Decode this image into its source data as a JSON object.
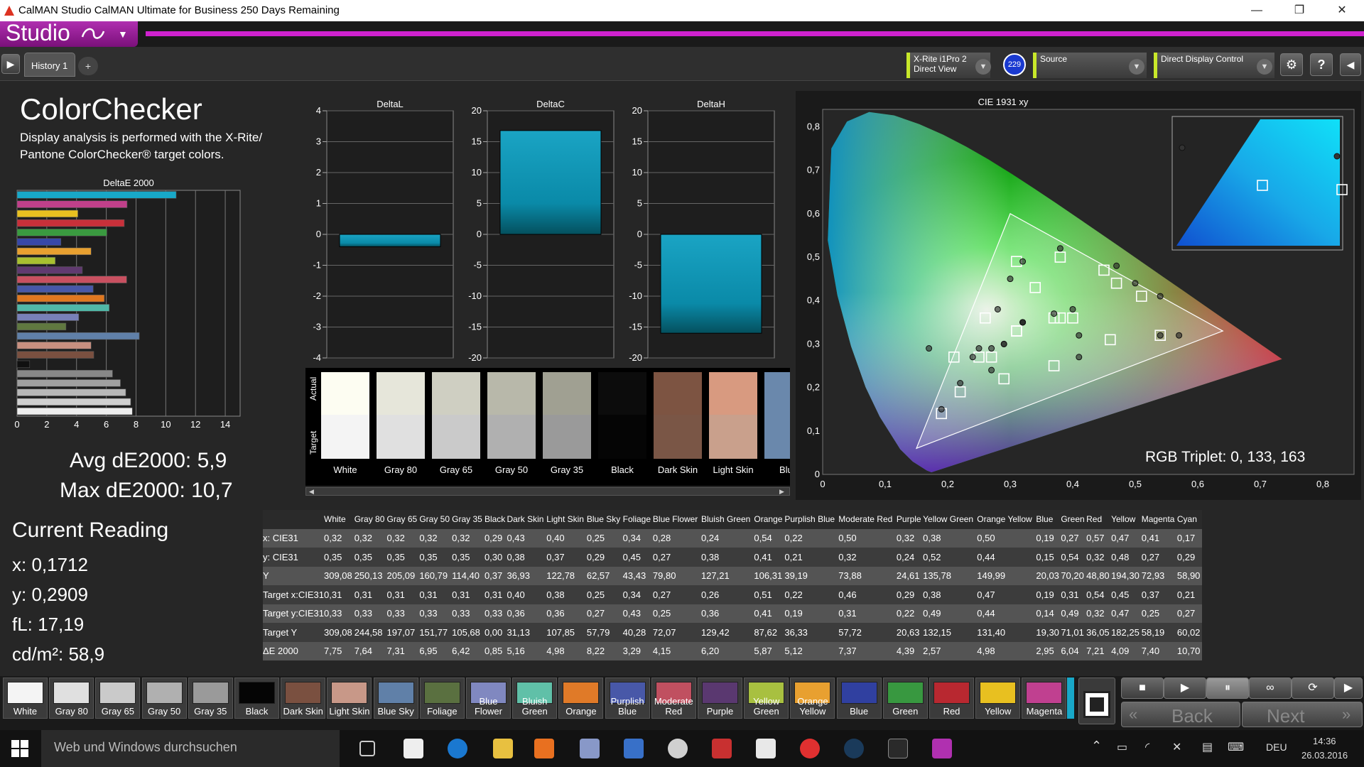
{
  "window": {
    "title": "CalMAN Studio CalMAN Ultimate for Business 250 Days Remaining",
    "minimize": "—",
    "restore": "❐",
    "close": "✕"
  },
  "app": {
    "brand": "Studio",
    "accent": "#cf22cf"
  },
  "toolbar": {
    "tab_label": "History 1",
    "add_tab": "+",
    "meter": {
      "line1": "X-Rite i1Pro 2",
      "line2": "Direct View",
      "badge": "229"
    },
    "source": "Source",
    "display_control": "Direct Display Control"
  },
  "header": {
    "title": "ColorChecker",
    "description_line1": "Display analysis is performed with the X-Rite/",
    "description_line2": "Pantone ColorChecker® target colors."
  },
  "summary": {
    "avg": "Avg dE2000: 5,9",
    "max": "Max dE2000: 10,7"
  },
  "current_reading": {
    "title": "Current Reading",
    "x": "x: 0,1712",
    "y": "y: 0,2909",
    "fl": "fL: 17,19",
    "cdm2": "cd/m²: 58,9"
  },
  "rgb_triplet": "RGB Triplet: 0, 133, 163",
  "chart_data": [
    {
      "type": "bar",
      "title": "DeltaE 2000",
      "orientation": "horizontal",
      "categories": [
        "Cyan",
        "Magenta",
        "Yellow",
        "Red",
        "Green",
        "Blue",
        "Orange Yellow",
        "Yellow Green",
        "Purple",
        "Moderate Red",
        "Purplish Blue",
        "Orange",
        "Bluish Green",
        "Blue Flower",
        "Foliage",
        "Blue Sky",
        "Light Skin",
        "Dark Skin",
        "Black",
        "Gray 35",
        "Gray 50",
        "Gray 65",
        "Gray 80",
        "White"
      ],
      "values": [
        10.7,
        7.4,
        4.09,
        7.21,
        6.04,
        2.95,
        4.98,
        2.57,
        4.39,
        7.37,
        5.12,
        5.87,
        6.2,
        4.15,
        3.29,
        8.22,
        4.98,
        5.16,
        0.85,
        6.42,
        6.95,
        7.31,
        7.64,
        7.75
      ],
      "colors": [
        "#18a8c8",
        "#c0408a",
        "#e8c020",
        "#c8303a",
        "#3a9a40",
        "#3848a8",
        "#e8a030",
        "#a8c030",
        "#603a70",
        "#c85060",
        "#4858a8",
        "#e07820",
        "#50b8a8",
        "#7880b8",
        "#607840",
        "#6080a8",
        "#c89080",
        "#7a5040",
        "#101010",
        "#888888",
        "#a0a0a0",
        "#b8b8b8",
        "#d0d0d0",
        "#eeeeee"
      ],
      "xlim": [
        0,
        15
      ],
      "xticks": [
        "0",
        "2",
        "4",
        "6",
        "8",
        "10",
        "12",
        "14"
      ]
    },
    {
      "type": "bar",
      "title": "DeltaL",
      "values": [
        -0.4
      ],
      "ylim": [
        -4,
        4
      ],
      "yticks": [
        "4",
        "3",
        "2",
        "1",
        "0",
        "-1",
        "-2",
        "-3",
        "-4"
      ]
    },
    {
      "type": "bar",
      "title": "DeltaC",
      "values": [
        16.8
      ],
      "ylim": [
        -20,
        20
      ],
      "yticks": [
        "20",
        "15",
        "10",
        "5",
        "0",
        "-5",
        "-10",
        "-15",
        "-20"
      ]
    },
    {
      "type": "bar",
      "title": "DeltaH",
      "values": [
        -16.0
      ],
      "ylim": [
        -20,
        20
      ],
      "yticks": [
        "20",
        "15",
        "10",
        "5",
        "0",
        "-5",
        "-10",
        "-15",
        "-20"
      ]
    },
    {
      "type": "scatter",
      "title": "CIE 1931 xy",
      "x_ticks": [
        "0",
        "0,1",
        "0,2",
        "0,3",
        "0,4",
        "0,5",
        "0,6",
        "0,7",
        "0,8"
      ],
      "y_ticks": [
        "0",
        "0,1",
        "0,2",
        "0,3",
        "0,4",
        "0,5",
        "0,6",
        "0,7",
        "0,8"
      ],
      "xlim": [
        0,
        0.85
      ],
      "ylim": [
        0,
        0.84
      ],
      "gamut": [
        [
          0.64,
          0.33
        ],
        [
          0.3,
          0.6
        ],
        [
          0.15,
          0.06
        ]
      ],
      "measured": [
        [
          0.17,
          0.29
        ],
        [
          0.41,
          0.27
        ],
        [
          0.47,
          0.48
        ],
        [
          0.41,
          0.32
        ],
        [
          0.32,
          0.49
        ],
        [
          0.5,
          0.44
        ],
        [
          0.54,
          0.41
        ],
        [
          0.22,
          0.21
        ],
        [
          0.3,
          0.45
        ],
        [
          0.19,
          0.15
        ],
        [
          0.54,
          0.32
        ],
        [
          0.38,
          0.52
        ],
        [
          0.28,
          0.38
        ],
        [
          0.27,
          0.29
        ],
        [
          0.29,
          0.3
        ],
        [
          0.29,
          0.3
        ],
        [
          0.37,
          0.37
        ],
        [
          0.4,
          0.38
        ],
        [
          0.27,
          0.24
        ],
        [
          0.25,
          0.29
        ],
        [
          0.24,
          0.27
        ],
        [
          0.32,
          0.35
        ],
        [
          0.32,
          0.35
        ],
        [
          0.32,
          0.35
        ],
        [
          0.57,
          0.32
        ]
      ],
      "target": [
        [
          0.21,
          0.27
        ],
        [
          0.37,
          0.25
        ],
        [
          0.45,
          0.47
        ],
        [
          0.37,
          0.36
        ],
        [
          0.31,
          0.49
        ],
        [
          0.47,
          0.44
        ],
        [
          0.51,
          0.41
        ],
        [
          0.22,
          0.19
        ],
        [
          0.34,
          0.43
        ],
        [
          0.19,
          0.14
        ],
        [
          0.46,
          0.31
        ],
        [
          0.38,
          0.5
        ],
        [
          0.26,
          0.36
        ],
        [
          0.27,
          0.27
        ],
        [
          0.25,
          0.27
        ],
        [
          0.29,
          0.22
        ],
        [
          0.38,
          0.36
        ],
        [
          0.4,
          0.36
        ],
        [
          0.31,
          0.33
        ],
        [
          0.31,
          0.33
        ],
        [
          0.31,
          0.33
        ],
        [
          0.31,
          0.33
        ],
        [
          0.54,
          0.32
        ],
        [
          0.31,
          0.33
        ]
      ]
    }
  ],
  "swatch_strip": {
    "actual_label": "Actual",
    "target_label": "Target",
    "items": [
      {
        "name": "White",
        "actual": "#fdfdf2",
        "target": "#f4f4f4"
      },
      {
        "name": "Gray 80",
        "actual": "#e6e6da",
        "target": "#e0e0e0"
      },
      {
        "name": "Gray 65",
        "actual": "#cfcfc2",
        "target": "#cacaca"
      },
      {
        "name": "Gray 50",
        "actual": "#b8b8aa",
        "target": "#b0b0b0"
      },
      {
        "name": "Gray 35",
        "actual": "#a0a092",
        "target": "#9a9a9a"
      },
      {
        "name": "Black",
        "actual": "#0c0c0c",
        "target": "#050505"
      },
      {
        "name": "Dark Skin",
        "actual": "#7d5442",
        "target": "#7a5646"
      },
      {
        "name": "Light Skin",
        "actual": "#d89a80",
        "target": "#c9a08c"
      },
      {
        "name": "Blue",
        "actual": "#6a88ac",
        "target": "#6a88ac"
      }
    ]
  },
  "table": {
    "columns": [
      "",
      "White",
      "Gray 80",
      "Gray 65",
      "Gray 50",
      "Gray 35",
      "Black",
      "Dark Skin",
      "Light Skin",
      "Blue Sky",
      "Foliage",
      "Blue Flower",
      "Bluish Green",
      "Orange",
      "Purplish Blue",
      "Moderate Red",
      "Purple",
      "Yellow Green",
      "Orange Yellow",
      "Blue",
      "Green",
      "Red",
      "Yellow",
      "Magenta",
      "Cyan"
    ],
    "rows": [
      [
        "x: CIE31",
        "0,32",
        "0,32",
        "0,32",
        "0,32",
        "0,32",
        "0,29",
        "0,43",
        "0,40",
        "0,25",
        "0,34",
        "0,28",
        "0,24",
        "0,54",
        "0,22",
        "0,50",
        "0,32",
        "0,38",
        "0,50",
        "0,19",
        "0,27",
        "0,57",
        "0,47",
        "0,41",
        "0,17"
      ],
      [
        "y: CIE31",
        "0,35",
        "0,35",
        "0,35",
        "0,35",
        "0,35",
        "0,30",
        "0,38",
        "0,37",
        "0,29",
        "0,45",
        "0,27",
        "0,38",
        "0,41",
        "0,21",
        "0,32",
        "0,24",
        "0,52",
        "0,44",
        "0,15",
        "0,54",
        "0,32",
        "0,48",
        "0,27",
        "0,29"
      ],
      [
        "Y",
        "309,08",
        "250,13",
        "205,09",
        "160,79",
        "114,40",
        "0,37",
        "36,93",
        "122,78",
        "62,57",
        "43,43",
        "79,80",
        "127,21",
        "106,31",
        "39,19",
        "73,88",
        "24,61",
        "135,78",
        "149,99",
        "20,03",
        "70,20",
        "48,80",
        "194,30",
        "72,93",
        "58,90"
      ],
      [
        "Target x:CIE31",
        "0,31",
        "0,31",
        "0,31",
        "0,31",
        "0,31",
        "0,31",
        "0,40",
        "0,38",
        "0,25",
        "0,34",
        "0,27",
        "0,26",
        "0,51",
        "0,22",
        "0,46",
        "0,29",
        "0,38",
        "0,47",
        "0,19",
        "0,31",
        "0,54",
        "0,45",
        "0,37",
        "0,21"
      ],
      [
        "Target y:CIE31",
        "0,33",
        "0,33",
        "0,33",
        "0,33",
        "0,33",
        "0,33",
        "0,36",
        "0,36",
        "0,27",
        "0,43",
        "0,25",
        "0,36",
        "0,41",
        "0,19",
        "0,31",
        "0,22",
        "0,49",
        "0,44",
        "0,14",
        "0,49",
        "0,32",
        "0,47",
        "0,25",
        "0,27"
      ],
      [
        "Target Y",
        "309,08",
        "244,58",
        "197,07",
        "151,77",
        "105,68",
        "0,00",
        "31,13",
        "107,85",
        "57,79",
        "40,28",
        "72,07",
        "129,42",
        "87,62",
        "36,33",
        "57,72",
        "20,63",
        "132,15",
        "131,40",
        "19,30",
        "71,01",
        "36,05",
        "182,25",
        "58,19",
        "60,02"
      ],
      [
        "ΔE 2000",
        "7,75",
        "7,64",
        "7,31",
        "6,95",
        "6,42",
        "0,85",
        "5,16",
        "4,98",
        "8,22",
        "3,29",
        "4,15",
        "6,20",
        "5,87",
        "5,12",
        "7,37",
        "4,39",
        "2,57",
        "4,98",
        "2,95",
        "6,04",
        "7,21",
        "4,09",
        "7,40",
        "10,70"
      ]
    ]
  },
  "bottom_swatches": [
    {
      "name": "White",
      "color": "#f4f4f4"
    },
    {
      "name": "Gray 80",
      "color": "#e0e0e0"
    },
    {
      "name": "Gray 65",
      "color": "#cacaca"
    },
    {
      "name": "Gray 50",
      "color": "#b0b0b0"
    },
    {
      "name": "Gray 35",
      "color": "#9a9a9a"
    },
    {
      "name": "Black",
      "color": "#050505"
    },
    {
      "name": "Dark Skin",
      "color": "#7a5040"
    },
    {
      "name": "Light Skin",
      "color": "#c89888"
    },
    {
      "name": "Blue Sky",
      "color": "#6080a8"
    },
    {
      "name": "Foliage",
      "color": "#5a7040"
    },
    {
      "name": "Blue Flower",
      "color": "#8088c0"
    },
    {
      "name": "Bluish Green",
      "color": "#60c0a8"
    },
    {
      "name": "Orange",
      "color": "#e07a28"
    },
    {
      "name": "Purplish Blue",
      "color": "#4858a8"
    },
    {
      "name": "Moderate Red",
      "color": "#c05060"
    },
    {
      "name": "Purple",
      "color": "#5a3870"
    },
    {
      "name": "Yellow Green",
      "color": "#a8c040"
    },
    {
      "name": "Orange Yellow",
      "color": "#e8a030"
    },
    {
      "name": "Blue",
      "color": "#3040a0"
    },
    {
      "name": "Green",
      "color": "#389840"
    },
    {
      "name": "Red",
      "color": "#b82830"
    },
    {
      "name": "Yellow",
      "color": "#e8c020"
    },
    {
      "name": "Magenta",
      "color": "#c04090"
    }
  ],
  "nav": {
    "back": "Back",
    "next": "Next"
  },
  "taskbar": {
    "search_placeholder": "Web und Windows durchsuchen",
    "lang": "DEU",
    "time": "14:36",
    "date": "26.03.2016"
  }
}
